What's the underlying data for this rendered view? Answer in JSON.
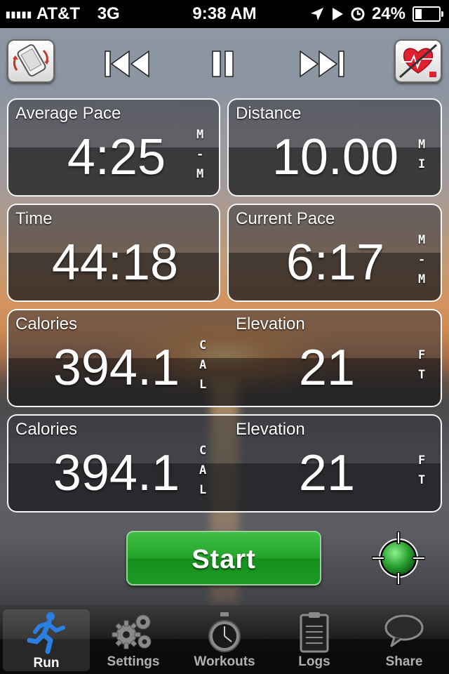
{
  "status_bar": {
    "signal": "▮▮▮▮▮",
    "carrier": "AT&T",
    "network": "3G",
    "time": "9:38 AM",
    "battery_percent": "24%",
    "battery_level": 0.24
  },
  "controls": {
    "rotate_icon": "phone-rotate-icon",
    "previous_icon": "skip-previous-icon",
    "pause_icon": "pause-icon",
    "next_icon": "skip-next-icon",
    "heart_icon": "heart-rate-off-icon"
  },
  "stats": {
    "average_pace": {
      "label": "Average Pace",
      "value": "4:25",
      "unit": [
        "M",
        "-",
        "M"
      ]
    },
    "distance": {
      "label": "Distance",
      "value": "10.00",
      "unit": [
        "M",
        "I"
      ]
    },
    "time": {
      "label": "Time",
      "value": "44:18"
    },
    "current_pace": {
      "label": "Current Pace",
      "value": "6:17",
      "unit": [
        "M",
        "-",
        "M"
      ]
    },
    "row3": {
      "calories": {
        "label": "Calories",
        "value": "394.1",
        "unit": [
          "C",
          "A",
          "L"
        ]
      },
      "elevation": {
        "label": "Elevation",
        "value": "21",
        "unit": [
          "F",
          "T"
        ]
      }
    },
    "row4": {
      "calories": {
        "label": "Calories",
        "value": "394.1",
        "unit": [
          "C",
          "A",
          "L"
        ]
      },
      "elevation": {
        "label": "Elevation",
        "value": "21",
        "unit": [
          "F",
          "T"
        ]
      }
    }
  },
  "start_button": {
    "label": "Start",
    "color": "#23a52a"
  },
  "gps_icon": "gps-target-icon",
  "tabs": [
    {
      "label": "Run",
      "icon": "runner-icon",
      "active": true
    },
    {
      "label": "Settings",
      "icon": "gears-icon",
      "active": false
    },
    {
      "label": "Workouts",
      "icon": "stopwatch-icon",
      "active": false
    },
    {
      "label": "Logs",
      "icon": "clipboard-icon",
      "active": false
    },
    {
      "label": "Share",
      "icon": "speech-bubble-icon",
      "active": false
    }
  ]
}
